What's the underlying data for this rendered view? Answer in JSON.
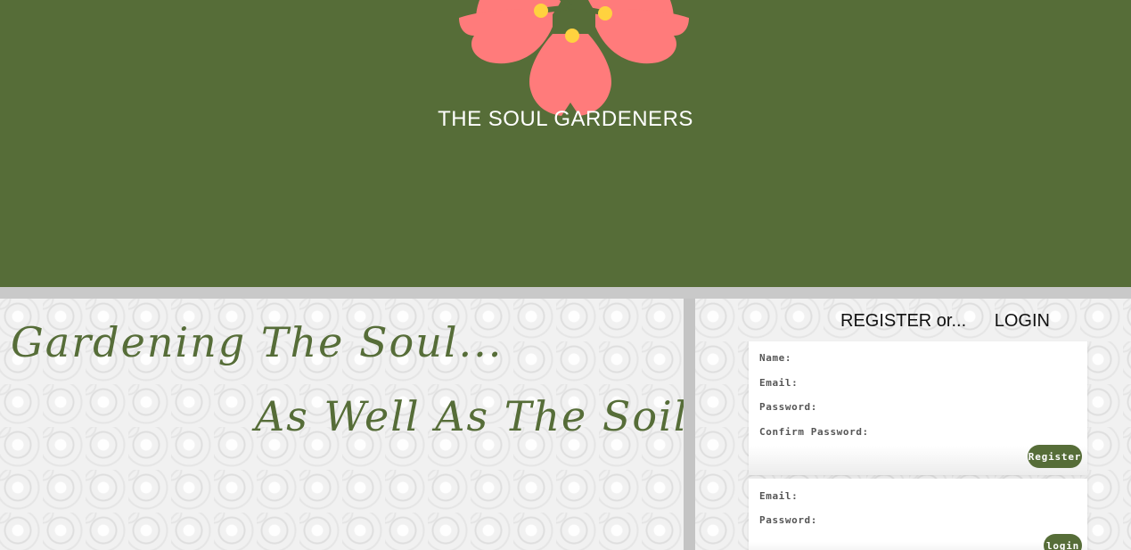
{
  "header": {
    "site_title": "THE SOUL GARDENERS",
    "logo_icon": "flower-icon",
    "background_color": "#566d38"
  },
  "hero": {
    "line1": "Gardening The Soul...",
    "line2": "As Well As The Soil",
    "text_color": "#566d38"
  },
  "auth": {
    "register_tab": "REGISTER or...",
    "login_tab": "LOGIN",
    "register_form": {
      "name_label": "Name:",
      "email_label": "Email:",
      "password_label": "Password:",
      "confirm_password_label": "Confirm Password:",
      "submit_label": "Register"
    },
    "login_form": {
      "email_label": "Email:",
      "password_label": "Password:",
      "submit_label": "login"
    }
  },
  "colors": {
    "accent": "#566d38",
    "petal": "#ff7b7b",
    "stamen": "#ffd23f",
    "panel_background": "#f1f1f1",
    "divider": "#c4c4c4"
  }
}
